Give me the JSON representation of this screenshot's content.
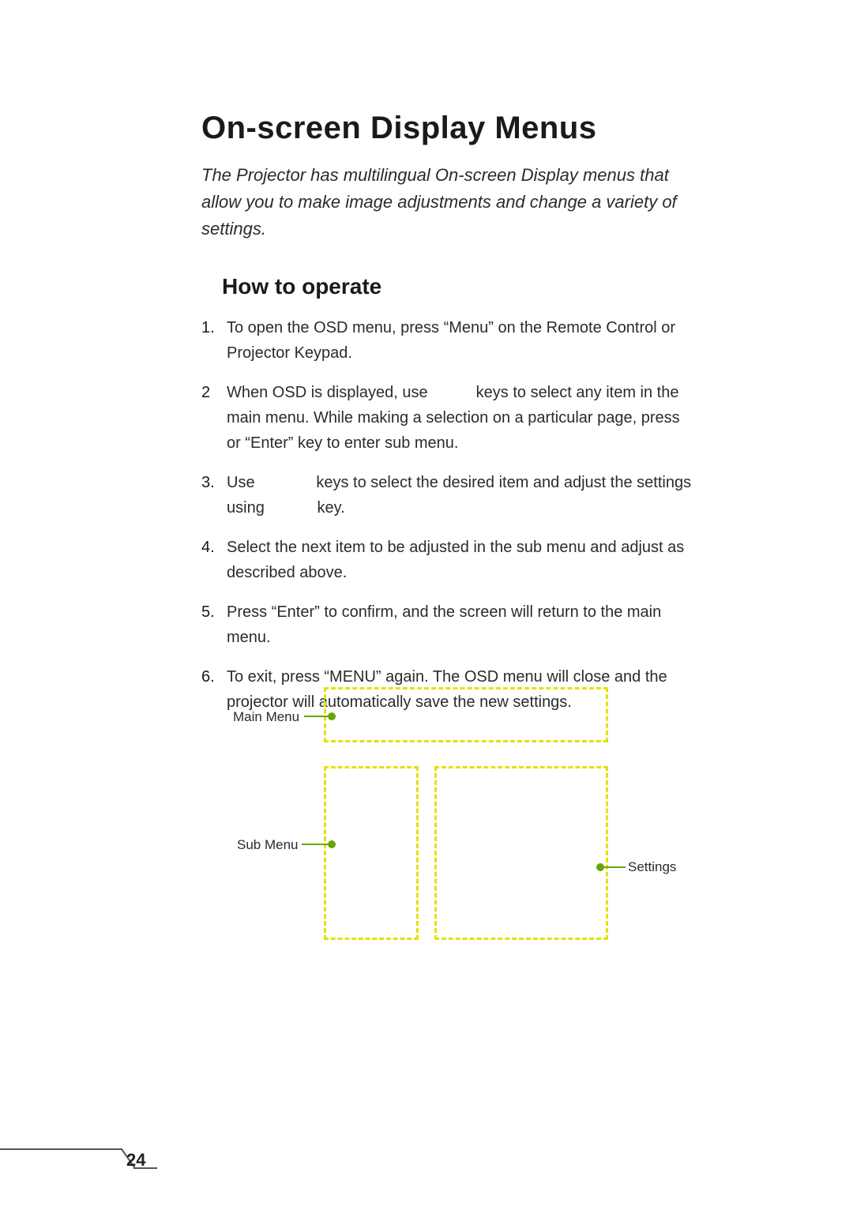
{
  "title": "On-screen Display Menus",
  "intro": "The Projector has multilingual On-screen Display menus that allow you to make image adjustments and change a variety of settings.",
  "subhead": "How to operate",
  "steps": [
    "To open the OSD menu, press “Menu” on the Remote Control or Projector Keypad.",
    "When OSD is displayed, use           keys to select any item in the main menu. While making a selection on a particular page, press        or “Enter” key to enter sub menu.",
    "Use              keys to select the desired item and adjust the settings using            key.",
    "Select the next item to be adjusted in the sub menu and adjust as described above.",
    "Press “Enter” to confirm, and the screen will return to the main menu.",
    "To exit, press “MENU” again. The OSD menu will close and the projector will automatically save the new settings."
  ],
  "diagram": {
    "main_label": "Main Menu",
    "sub_label": "Sub Menu",
    "settings_label": "Settings"
  },
  "page_number": "24"
}
